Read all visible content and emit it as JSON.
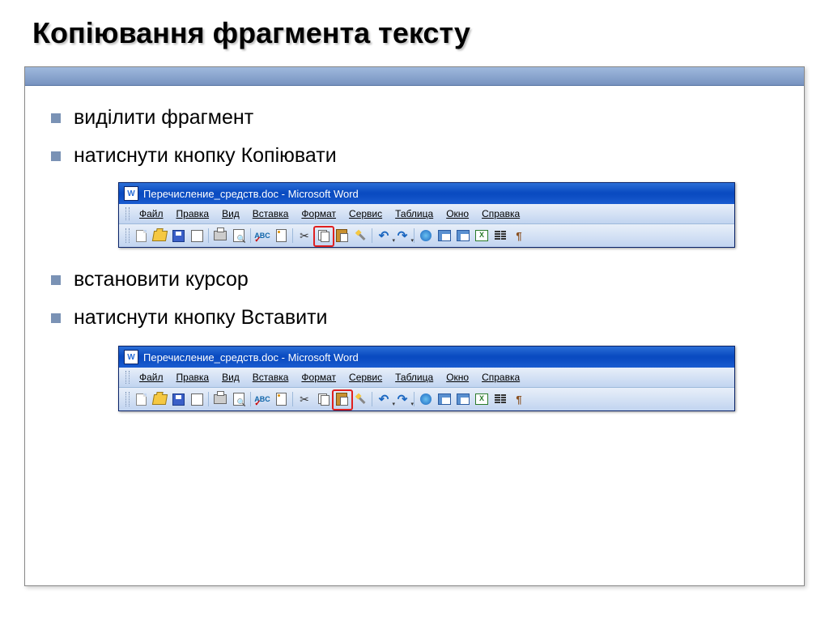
{
  "slide": {
    "title": "Копіювання фрагмента тексту",
    "bullets": [
      "виділити фрагмент",
      "натиснути кнопку Копіювати",
      "встановити курсор",
      "натиснути кнопку Вставити"
    ]
  },
  "word_window": {
    "title": "Перечисление_средств.doc - Microsoft Word",
    "menus": [
      "Файл",
      "Правка",
      "Вид",
      "Вставка",
      "Формат",
      "Сервис",
      "Таблица",
      "Окно",
      "Справка"
    ]
  },
  "highlights": {
    "first": "copy",
    "second": "paste"
  }
}
